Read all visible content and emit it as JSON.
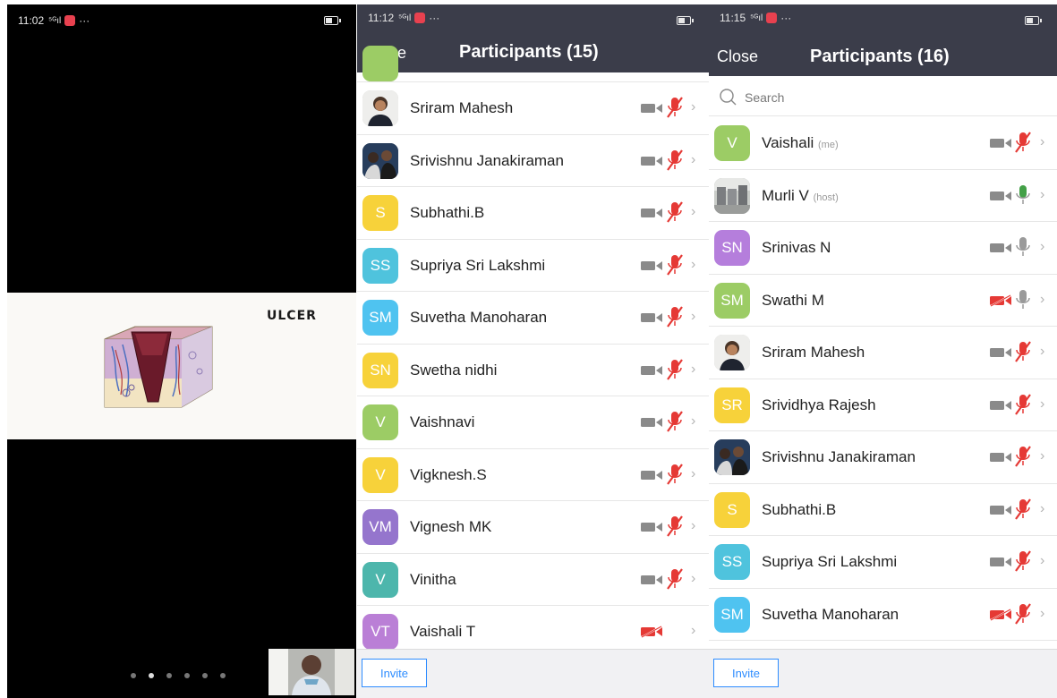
{
  "screen1": {
    "status": {
      "time": "11:02",
      "signal": "⁵ᴳıl",
      "more": "···"
    },
    "slide_title": "ULCER",
    "pages": 6,
    "active_page": 1
  },
  "screen2": {
    "status": {
      "time": "11:12",
      "signal": "⁵ᴳıl",
      "more": "···"
    },
    "close_label": "Close",
    "title": "Participants (15)",
    "invite_label": "Invite",
    "participants": [
      {
        "name": "Sriram Mahesh",
        "initials": "",
        "color": "#c8c8c8",
        "photo": "person",
        "video": "on",
        "mic": "muted"
      },
      {
        "name": "Srivishnu Janakiraman",
        "initials": "",
        "color": "#3a5476",
        "photo": "group",
        "video": "on",
        "mic": "muted"
      },
      {
        "name": "Subhathi.B",
        "initials": "S",
        "color": "#f7d23a",
        "video": "on",
        "mic": "muted"
      },
      {
        "name": "Supriya Sri Lakshmi",
        "initials": "SS",
        "color": "#4fc3dd",
        "video": "on",
        "mic": "muted"
      },
      {
        "name": "Suvetha Manoharan",
        "initials": "SM",
        "color": "#4fc3f0",
        "video": "on",
        "mic": "muted"
      },
      {
        "name": "Swetha nidhi",
        "initials": "SN",
        "color": "#f7d23a",
        "video": "on",
        "mic": "muted"
      },
      {
        "name": "Vaishnavi",
        "initials": "V",
        "color": "#9ccc65",
        "video": "on",
        "mic": "muted"
      },
      {
        "name": "Vigknesh.S",
        "initials": "V",
        "color": "#f7d23a",
        "video": "on",
        "mic": "muted"
      },
      {
        "name": "Vignesh MK",
        "initials": "VM",
        "color": "#9575cd",
        "video": "on",
        "mic": "muted"
      },
      {
        "name": "Vinitha",
        "initials": "V",
        "color": "#4db6ac",
        "video": "on",
        "mic": "muted"
      },
      {
        "name": "Vaishali T",
        "initials": "VT",
        "color": "#ba7fd6",
        "video": "off",
        "mic": "none"
      }
    ]
  },
  "screen3": {
    "status": {
      "time": "11:15",
      "signal": "⁵ᴳıl",
      "more": "···"
    },
    "close_label": "Close",
    "title": "Participants (16)",
    "search_placeholder": "Search",
    "invite_label": "Invite",
    "participants": [
      {
        "name": "Vaishali",
        "tag": "(me)",
        "initials": "V",
        "color": "#9ccc65",
        "video": "on",
        "mic": "muted"
      },
      {
        "name": "Murli V",
        "tag": "(host)",
        "initials": "",
        "color": "#8a8f96",
        "photo": "landscape",
        "video": "on",
        "mic": "active"
      },
      {
        "name": "Srinivas N",
        "initials": "SN",
        "color": "#b57edc",
        "video": "on",
        "mic": "idle"
      },
      {
        "name": "Swathi M",
        "initials": "SM",
        "color": "#9ccc65",
        "video": "off",
        "mic": "idle"
      },
      {
        "name": "Sriram Mahesh",
        "initials": "",
        "color": "#c8c8c8",
        "photo": "person",
        "video": "on",
        "mic": "muted"
      },
      {
        "name": "Srividhya Rajesh",
        "initials": "SR",
        "color": "#f7d23a",
        "video": "on",
        "mic": "muted"
      },
      {
        "name": "Srivishnu Janakiraman",
        "initials": "",
        "color": "#3a5476",
        "photo": "group",
        "video": "on",
        "mic": "muted"
      },
      {
        "name": "Subhathi.B",
        "initials": "S",
        "color": "#f7d23a",
        "video": "on",
        "mic": "muted"
      },
      {
        "name": "Supriya Sri Lakshmi",
        "initials": "SS",
        "color": "#4fc3dd",
        "video": "on",
        "mic": "muted"
      },
      {
        "name": "Suvetha Manoharan",
        "initials": "SM",
        "color": "#4fc3f0",
        "video": "off",
        "mic": "muted"
      }
    ]
  }
}
